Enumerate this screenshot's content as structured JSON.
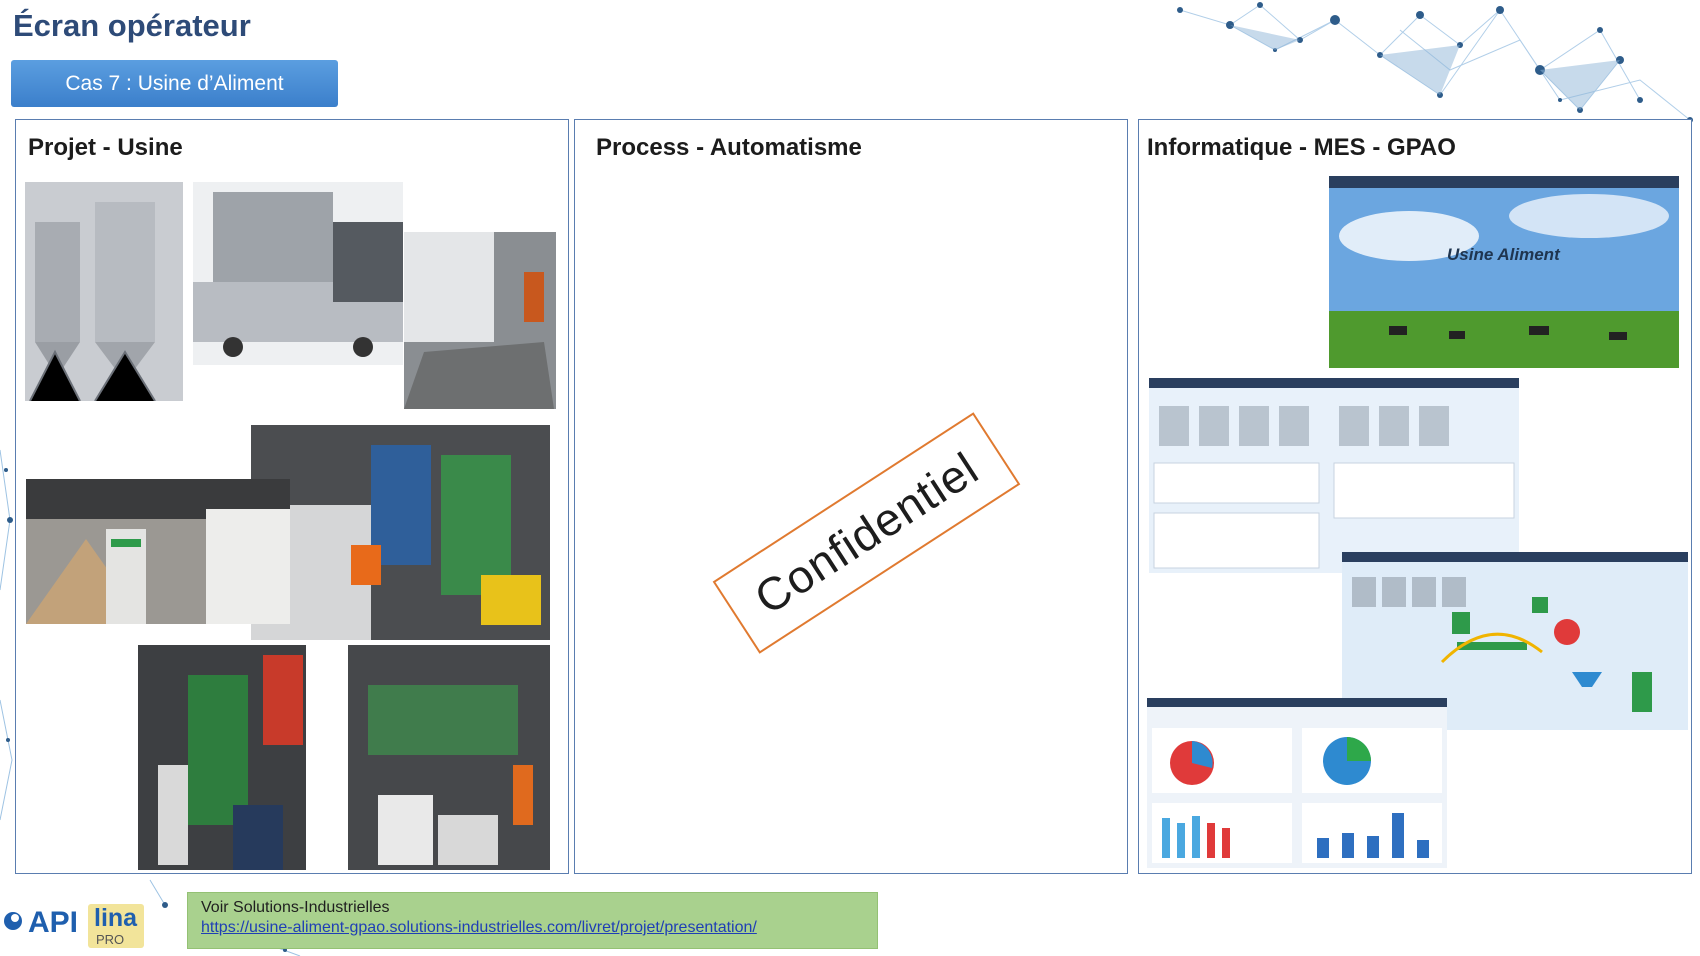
{
  "header": {
    "title": "Écran opérateur",
    "case_label": "Cas 7 : Usine d’Aliment"
  },
  "panels": {
    "factory": {
      "title": "Projet - Usine"
    },
    "process": {
      "title": "Process - Automatisme",
      "stamp": "Confidentiel"
    },
    "it": {
      "title": "Informatique - MES - GPAO",
      "hero_caption": "Usine Aliment"
    }
  },
  "footer": {
    "link_label": "Voir Solutions-Industrielles",
    "link_url": "https://usine-aliment-gpao.solutions-industrielles.com/livret/projet/presentation/",
    "logo_api": "API",
    "logo_lina": "lina",
    "logo_pro": "PRO"
  },
  "colors": {
    "title": "#2e4b78",
    "badge": "#4a8fd8",
    "panel_border": "#5a7db0",
    "stamp_border": "#e07a30",
    "link_box": "#a9d18e",
    "link_text": "#1f3fb5"
  }
}
